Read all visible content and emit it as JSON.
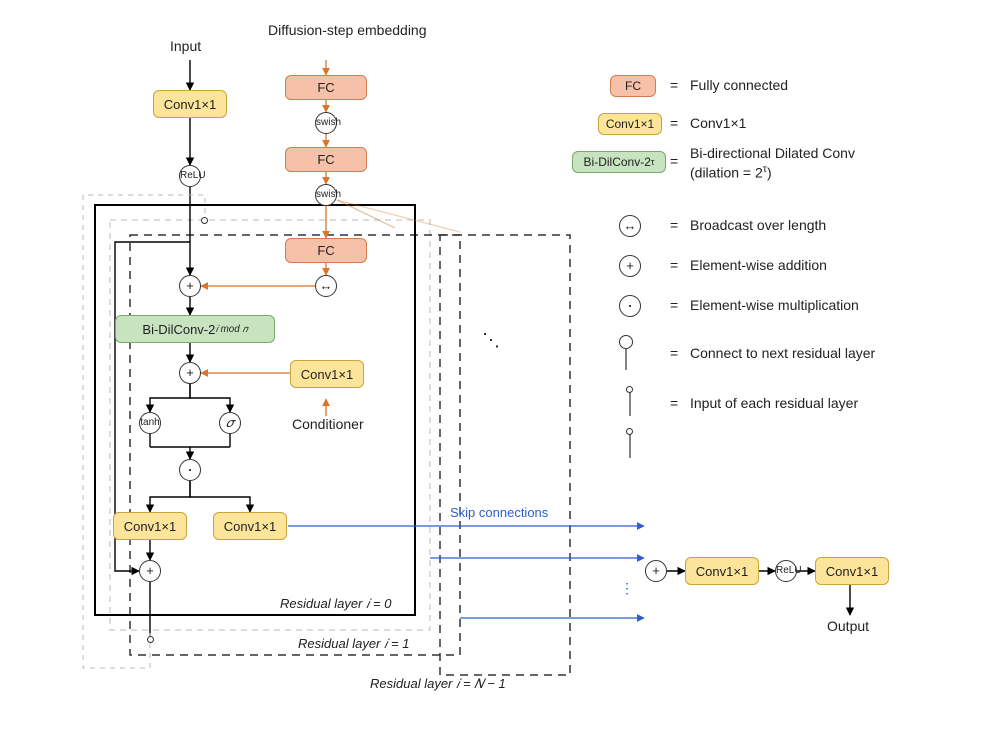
{
  "headers": {
    "input": "Input",
    "diffusion": "Diffusion-step embedding",
    "conditioner": "Conditioner",
    "output": "Output",
    "skip": "Skip connections",
    "residual0": "Residual layer 𝑖 = 0",
    "residual1": "Residual layer 𝑖 = 1",
    "residualN": "Residual layer 𝑖 = 𝑁 − 1"
  },
  "blocks": {
    "fc": "FC",
    "conv1x1": "Conv1×1",
    "bidil_layer": "Bi-DilConv-2",
    "bidil_exp_layer": "𝑖 mod 𝑛",
    "bidil_legend": "Bi-DilConv-2",
    "bidil_exp_legend": "τ"
  },
  "ops": {
    "relu": "ReLU",
    "swish": "swish",
    "plus": "+",
    "dot": "·",
    "tanh": "tanh",
    "sigma": "𝜎",
    "broadcast": "↔"
  },
  "legend": {
    "fc": "Fully connected",
    "conv": "Conv1×1",
    "bidil_line1": "Bi-directional Dilated Conv",
    "bidil_line2": "(dilation = 2",
    "bidil_line2_tail": ")",
    "bidil_sup": "τ",
    "broadcast": "Broadcast over length",
    "add": "Element-wise addition",
    "mul": "Element-wise multiplication",
    "connect_next": "Connect to next residual layer",
    "input_each": "Input of each residual layer",
    "eq": "="
  },
  "misc": {
    "ellipsis": "⋱",
    "vdots": "⋮"
  }
}
